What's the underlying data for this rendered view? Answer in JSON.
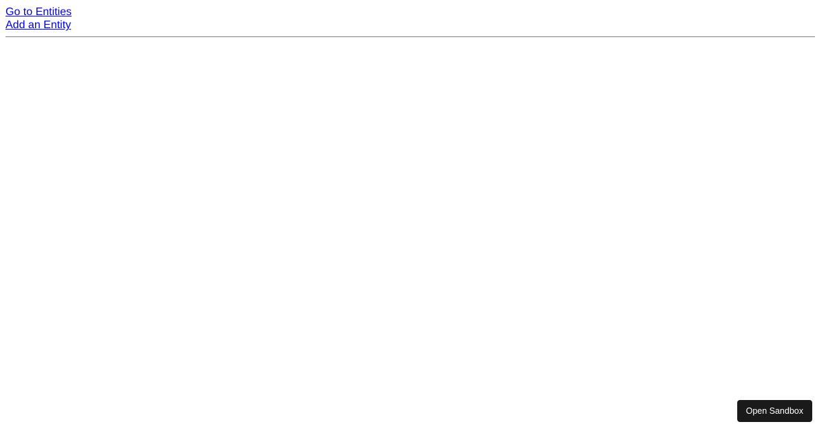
{
  "nav": {
    "links": [
      {
        "label": "Go to Entities"
      },
      {
        "label": "Add an Entity"
      }
    ]
  },
  "sandbox": {
    "button_label": "Open Sandbox"
  }
}
